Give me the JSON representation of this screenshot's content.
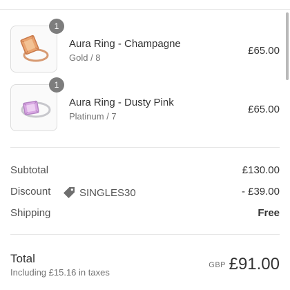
{
  "items": [
    {
      "quantity": "1",
      "name": "Aura Ring - Champagne",
      "variant": "Gold / 8",
      "price": "£65.00",
      "image": "champagne-ring-image"
    },
    {
      "quantity": "1",
      "name": "Aura Ring - Dusty Pink",
      "variant": "Platinum / 7",
      "price": "£65.00",
      "image": "dusty-pink-ring-image"
    }
  ],
  "summary": {
    "subtotal_label": "Subtotal",
    "subtotal_value": "£130.00",
    "discount_label": "Discount",
    "discount_code": "SINGLES30",
    "discount_icon": "tag-icon",
    "discount_value": "- £39.00",
    "shipping_label": "Shipping",
    "shipping_value": "Free"
  },
  "total": {
    "label": "Total",
    "taxes_note": "Including £15.16 in taxes",
    "currency": "GBP",
    "amount": "£91.00"
  },
  "colors": {
    "badge": "#7d7d7d",
    "text": "#333333",
    "muted": "#737373"
  }
}
